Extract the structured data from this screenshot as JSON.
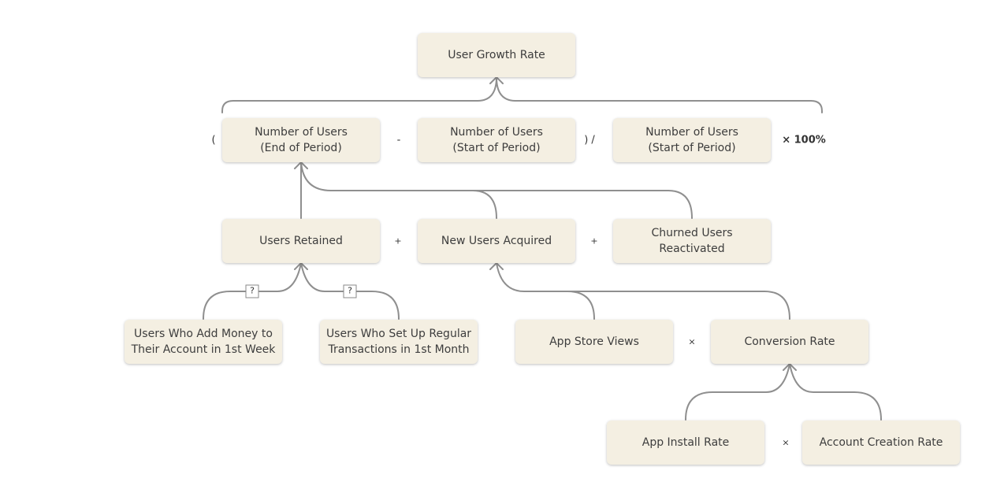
{
  "nodes": {
    "user_growth_rate": "User Growth Rate",
    "users_end": "Number of Users\n(End of Period)",
    "users_start_1": "Number of Users\n(Start of Period)",
    "users_start_2": "Number of Users\n(Start of Period)",
    "users_retained": "Users Retained",
    "new_users_acquired": "New Users Acquired",
    "churned_reactivated": "Churned Users\nReactivated",
    "add_money": "Users Who Add Money to\nTheir Account in 1st Week",
    "regular_transactions": "Users Who Set Up Regular\nTransactions in 1st Month",
    "app_store_views": "App Store Views",
    "conversion_rate": "Conversion Rate",
    "app_install_rate": "App Install Rate",
    "account_creation_rate": "Account Creation Rate"
  },
  "operators": {
    "open_paren": "(",
    "minus": "-",
    "close_paren_div": ") /",
    "times_100": "× 100%",
    "plus_1": "+",
    "plus_2": "+",
    "times_1": "×",
    "times_2": "×"
  },
  "unknown_links": [
    "?",
    "?"
  ],
  "colors": {
    "node_fill": "#f4efe2",
    "connector": "#8f8f8f"
  }
}
